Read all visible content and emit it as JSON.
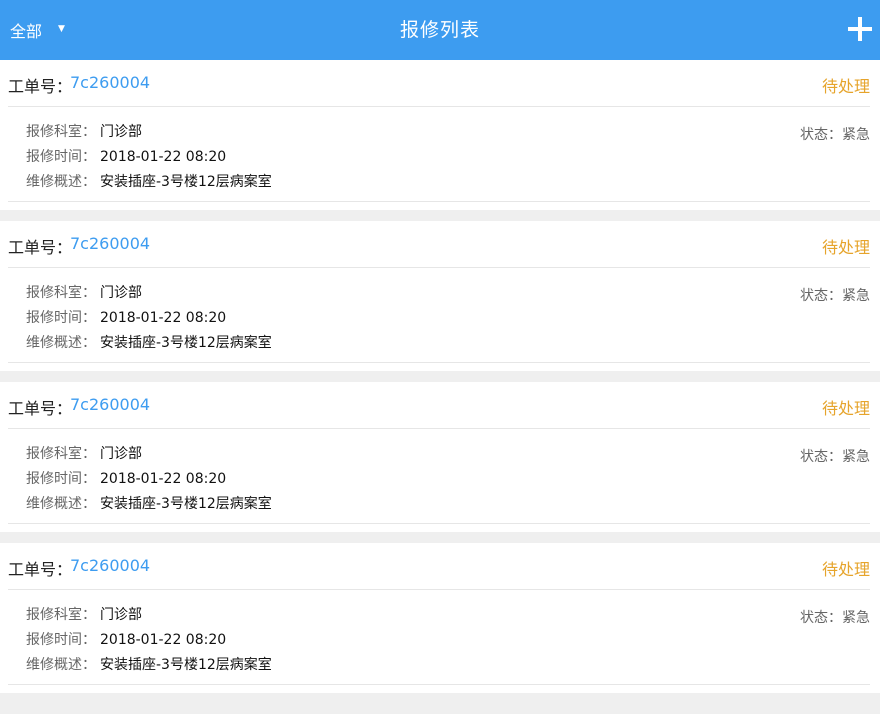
{
  "header": {
    "filter_label": "全部",
    "title": "报修列表",
    "add_icon": "plus-icon"
  },
  "colors": {
    "header_bg": "#3d9cf0",
    "order_no": "#3d9cf0",
    "pending": "#e6a42b"
  },
  "labels": {
    "order": "工单号：",
    "dept": "报修科室：",
    "time": "报修时间：",
    "desc": "维修概述：",
    "status": "状态：",
    "filter_caret": "▼"
  },
  "cards": [
    {
      "order_no": "7c260004",
      "state": "待处理",
      "dept": "门诊部",
      "time": "2018-01-22 08:20",
      "desc": "安装插座-3号楼12层病案室",
      "urgency": "紧急"
    },
    {
      "order_no": "7c260004",
      "state": "待处理",
      "dept": "门诊部",
      "time": "2018-01-22 08:20",
      "desc": "安装插座-3号楼12层病案室",
      "urgency": "紧急"
    },
    {
      "order_no": "7c260004",
      "state": "待处理",
      "dept": "门诊部",
      "time": "2018-01-22 08:20",
      "desc": "安装插座-3号楼12层病案室",
      "urgency": "紧急"
    },
    {
      "order_no": "7c260004",
      "state": "待处理",
      "dept": "门诊部",
      "time": "2018-01-22 08:20",
      "desc": "安装插座-3号楼12层病案室",
      "urgency": "紧急"
    }
  ]
}
